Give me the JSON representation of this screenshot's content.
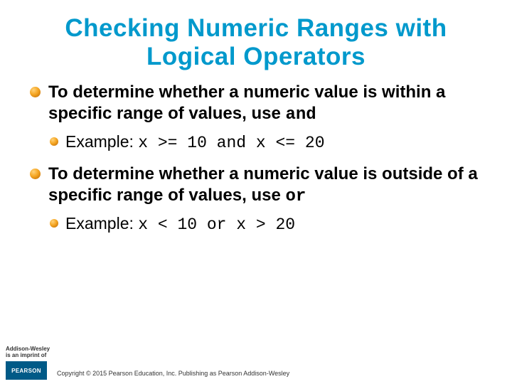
{
  "title": "Checking Numeric Ranges with Logical Operators",
  "bullets": [
    {
      "lead": "To determine whether a numeric value is within a specific range of values, use ",
      "keyword": "and",
      "example_label": "Example: ",
      "example_code": "x >= 10 and x <= 20"
    },
    {
      "lead": "To determine whether a numeric value is outside of a specific range of values, use ",
      "keyword": "or",
      "example_label": "Example: ",
      "example_code": "x < 10 or x > 20"
    }
  ],
  "footer": {
    "imprint_line1": "Addison-Wesley",
    "imprint_line2": "is an imprint of",
    "logo_text": "PEARSON",
    "copyright": "Copyright © 2015 Pearson Education, Inc. Publishing as Pearson Addison-Wesley"
  }
}
